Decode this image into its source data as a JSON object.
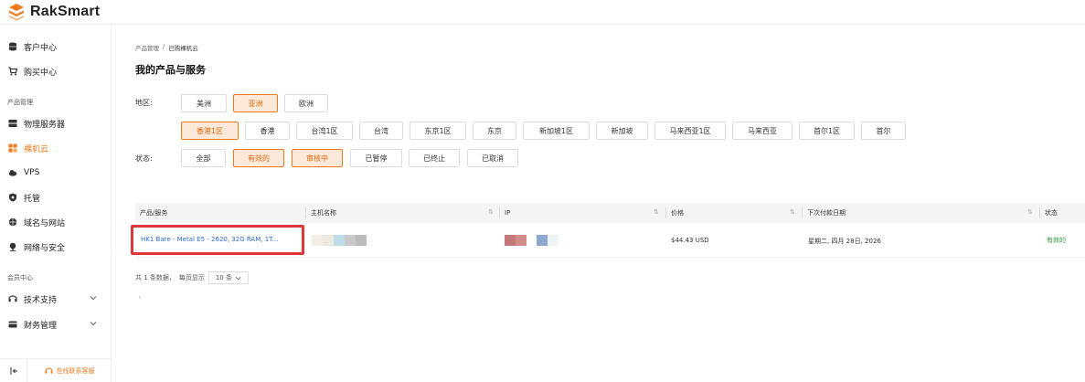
{
  "brand": {
    "name": "RakSmart",
    "accent": "#f07a1e"
  },
  "sidebar": {
    "items_top": [
      {
        "label": "客户中心",
        "icon": "database-icon"
      },
      {
        "label": "购买中心",
        "icon": "cart-icon"
      }
    ],
    "group_products": "产品管理",
    "items_products": [
      {
        "label": "物理服务器",
        "icon": "server-icon"
      },
      {
        "label": "裸机云",
        "icon": "cluster-icon",
        "active": true
      },
      {
        "label": "VPS",
        "icon": "cloud-icon"
      },
      {
        "label": "托管",
        "icon": "shield-icon"
      },
      {
        "label": "域名与网站",
        "icon": "domain-icon"
      },
      {
        "label": "网络与安全",
        "icon": "network-icon"
      }
    ],
    "group_member": "会员中心",
    "items_member": [
      {
        "label": "技术支持",
        "icon": "support-icon"
      },
      {
        "label": "财务管理",
        "icon": "finance-icon"
      }
    ],
    "support_label": "在线联系客服"
  },
  "breadcrumb": {
    "parent": "产品管理",
    "sep": "/",
    "current": "已购裸机云"
  },
  "page_title": "我的产品与服务",
  "filters": {
    "region_label": "地区:",
    "regions": [
      "美洲",
      "亚洲",
      "欧洲"
    ],
    "region_selected": "亚洲",
    "zones": [
      "香港1区",
      "香港",
      "台湾1区",
      "台湾",
      "东京1区",
      "东京",
      "新加坡1区",
      "新加坡",
      "马来西亚1区",
      "马来西亚",
      "首尔1区",
      "首尔"
    ],
    "zone_selected": "香港1区",
    "status_label": "状态:",
    "statuses": [
      "全部",
      "有效的",
      "审核中",
      "已暂停",
      "已终止",
      "已取消"
    ],
    "status_selected": [
      "有效的",
      "审核中"
    ]
  },
  "table": {
    "headers": [
      "产品/服务",
      "主机名称",
      "IP",
      "价格",
      "下次付款日期",
      "状态"
    ],
    "rows": [
      {
        "product": "HK1 Bare - Metal E5 - 2620, 32G RAM, 1T...",
        "price": "$44.43 USD",
        "next_payment": "星期二, 四月 28日, 2026",
        "status": "有效的"
      }
    ]
  },
  "pagination": {
    "total_text": "共 1 条数据，",
    "per_page_text": "每页显示",
    "page_size": "10 条"
  },
  "colors": {
    "accent": "#f07a1e",
    "link": "#2b6bd6",
    "active_status": "#2a9d3a",
    "highlight": "#e0373a"
  }
}
